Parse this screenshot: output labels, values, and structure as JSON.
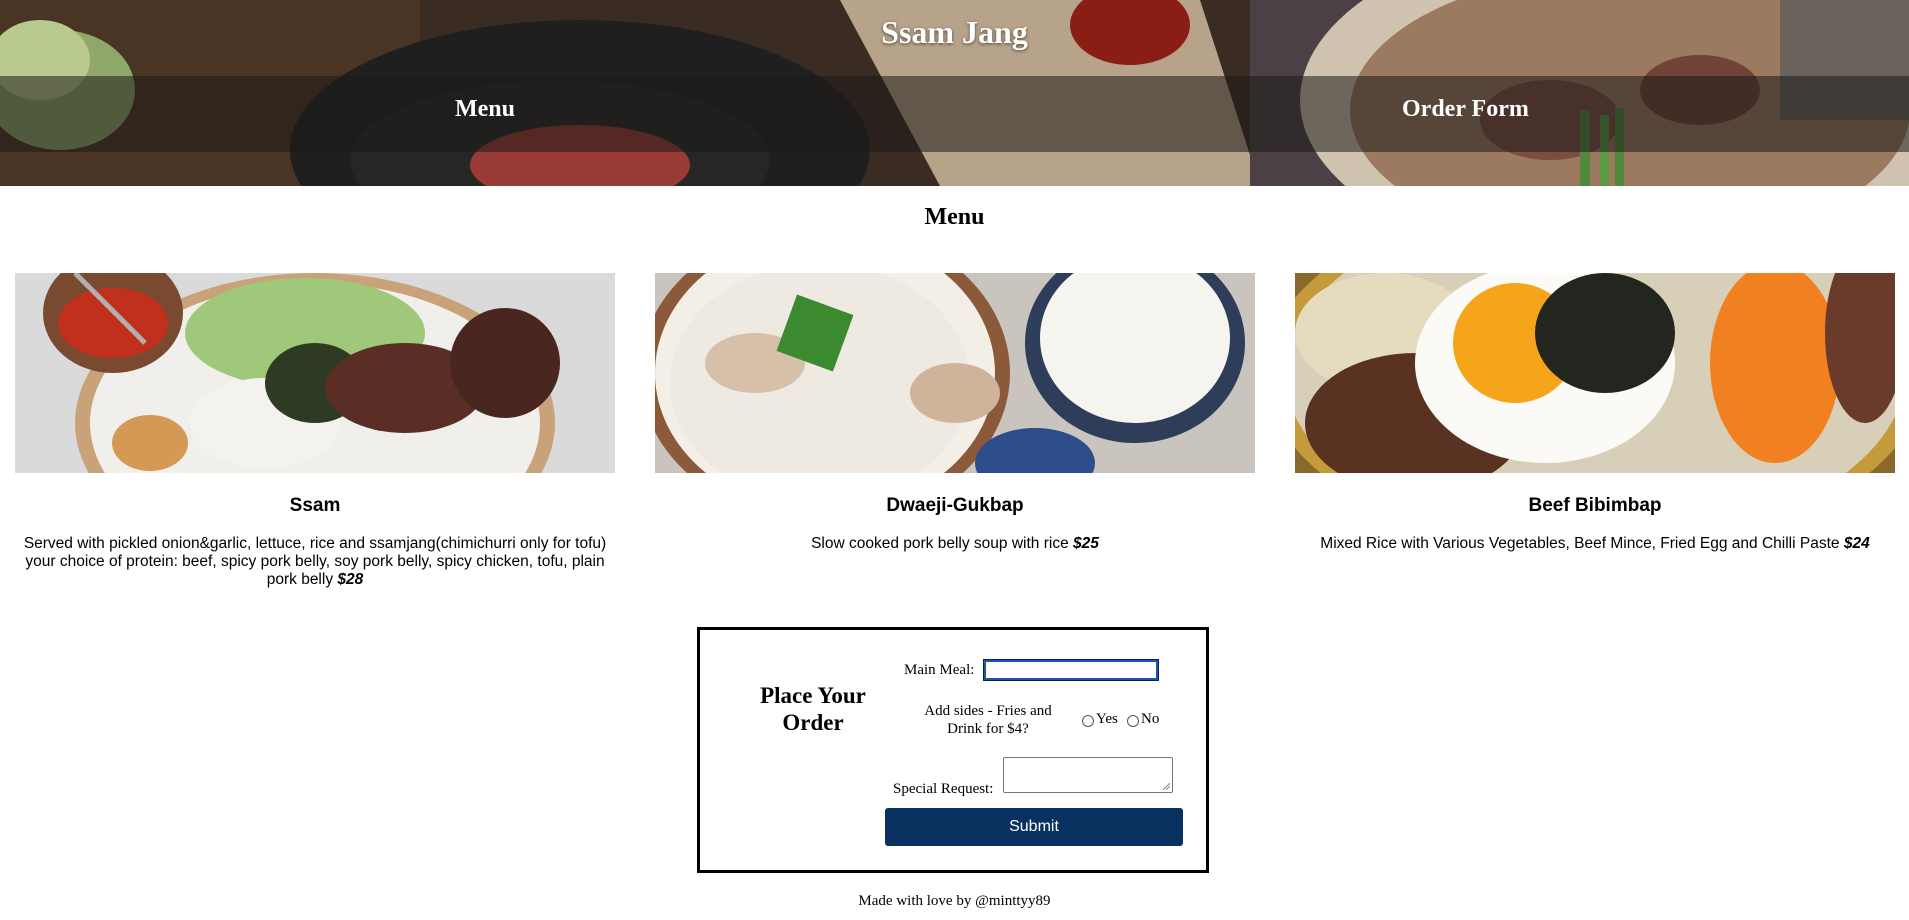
{
  "header": {
    "site_title": "Ssam Jang",
    "nav": [
      {
        "label": "Menu"
      },
      {
        "label": "Order Form"
      }
    ]
  },
  "menu": {
    "heading": "Menu",
    "items": [
      {
        "name": "Ssam",
        "description": "Served with pickled onion&garlic, lettuce, rice and ssamjang(chimichurri only for tofu) your choice of protein: beef, spicy pork belly, soy pork belly, spicy chicken, tofu, plain pork belly",
        "price": "$28"
      },
      {
        "name": "Dwaeji-Gukbap",
        "description": "Slow cooked pork belly soup with rice",
        "price": "$25"
      },
      {
        "name": "Beef Bibimbap",
        "description": "Mixed Rice with Various Vegetables, Beef Mince, Fried Egg and Chilli Paste",
        "price": "$24"
      }
    ]
  },
  "order_form": {
    "title": "Place Your Order",
    "main_meal_label": "Main Meal:",
    "main_meal_value": "",
    "sides_label": "Add sides - Fries and Drink for $4?",
    "sides_options": [
      "Yes",
      "No"
    ],
    "special_request_label": "Special Request:",
    "special_request_value": "",
    "submit_label": "Submit"
  },
  "footer": {
    "text": "Made with love by @minttyy89"
  },
  "colors": {
    "submit_bg": "#09315f",
    "input_focus": "#1a56b0"
  }
}
